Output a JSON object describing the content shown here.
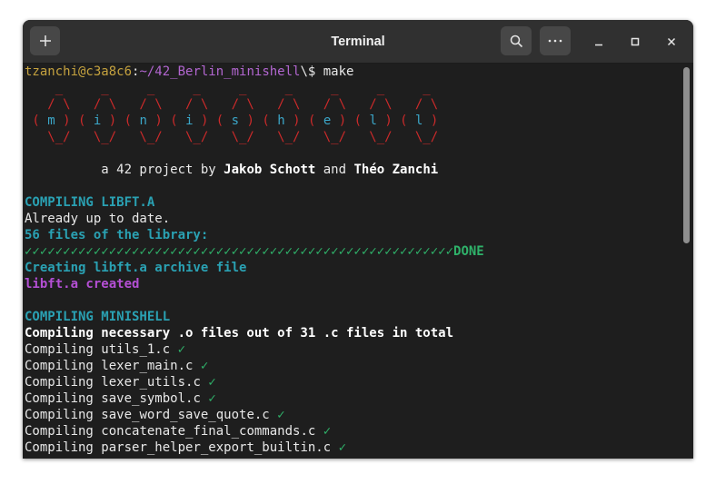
{
  "window": {
    "title": "Terminal",
    "buttons": {
      "new_tab": "new-tab-icon",
      "search": "search-icon",
      "menu": "more-horizontal-icon",
      "minimize": "minimize-icon",
      "maximize": "maximize-icon",
      "close": "close-icon"
    }
  },
  "prompt": {
    "user_host": "tzanchi@c3a8c6",
    "colon": ":",
    "path": "~/42_Berlin_minishell",
    "symbol": "\\$",
    "command": " make"
  },
  "banner": {
    "row1": "    _     _     _     _     _     _     _     _     _",
    "row2": "   / \\   / \\   / \\   / \\   / \\   / \\   / \\   / \\   / \\",
    "row3_letters": [
      "m",
      "i",
      "n",
      "i",
      "s",
      "h",
      "e",
      "l",
      "l"
    ],
    "row4": "   \\_/   \\_/   \\_/   \\_/   \\_/   \\_/   \\_/   \\_/   \\_/",
    "credit_prefix": "          a 42 project by ",
    "author1": "Jakob Schott",
    "credit_and": " and ",
    "author2": "Théo Zanchi"
  },
  "libft": {
    "header": "COMPILING LIBFT.A",
    "up_to_date": "Already up to date.",
    "file_count": "56 files of the library:",
    "progress": "✓✓✓✓✓✓✓✓✓✓✓✓✓✓✓✓✓✓✓✓✓✓✓✓✓✓✓✓✓✓✓✓✓✓✓✓✓✓✓✓✓✓✓✓✓✓✓✓✓✓✓✓✓✓✓✓",
    "done": "DONE",
    "creating": "Creating libft.a archive file",
    "created": "libft.a created"
  },
  "minishell": {
    "header": "COMPILING MINISHELL",
    "summary": "Compiling necessary .o files out of 31 .c files in total",
    "compiling_prefix": "Compiling ",
    "check": " ✓",
    "files": [
      "utils_1.c",
      "lexer_main.c",
      "lexer_utils.c",
      "save_symbol.c",
      "save_word_save_quote.c",
      "concatenate_final_commands.c",
      "parser_helper_export_builtin.c"
    ]
  }
}
